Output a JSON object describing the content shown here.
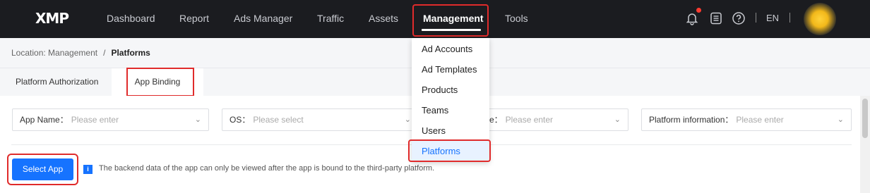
{
  "app": {
    "logo_text": "XMP"
  },
  "nav": {
    "items": [
      "Dashboard",
      "Report",
      "Ads Manager",
      "Traffic",
      "Assets",
      "Management",
      "Tools"
    ],
    "active": "Management",
    "lang": "EN",
    "icons": [
      "bell-icon",
      "document-icon",
      "help-icon"
    ]
  },
  "breadcrumb": {
    "location": "Location: Management",
    "separator": "/",
    "current": "Platforms"
  },
  "tabs": [
    "Platform Authorization",
    "App Binding"
  ],
  "filters": {
    "app_name": {
      "label": "App Name：",
      "placeholder": "Please enter"
    },
    "os": {
      "label": "OS：",
      "placeholder": "Please select"
    },
    "third": {
      "label": "me：",
      "placeholder": "Please enter"
    },
    "platform_info": {
      "label": "Platform information：",
      "placeholder": "Please enter"
    }
  },
  "select_app": {
    "label": "Select App"
  },
  "info": {
    "icon": "i",
    "text": "The backend data of the app can only be viewed after the app is bound to the third-party platform."
  },
  "dropdown": {
    "items": [
      "Ad Accounts",
      "Ad Templates",
      "Products",
      "Teams",
      "Users",
      "Platforms"
    ],
    "selected": "Platforms"
  },
  "colors": {
    "accent": "#1673ff",
    "highlight": "#e02b2b",
    "nav_bg": "#1b1c20"
  }
}
